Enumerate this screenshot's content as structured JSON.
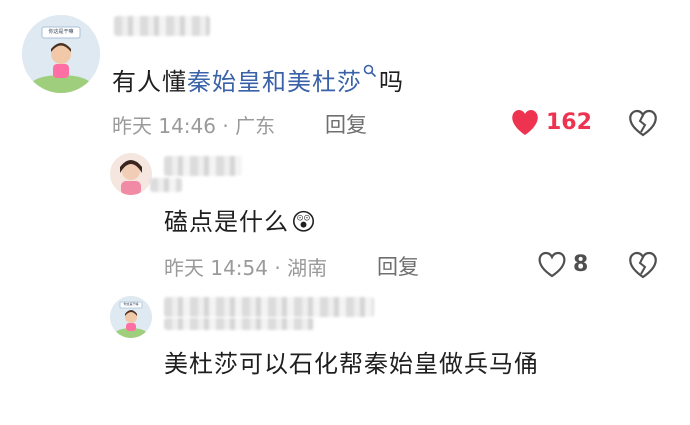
{
  "comments": [
    {
      "avatar_caption": "你这是干嘛",
      "text_before": "有人懂",
      "text_link": "秦始皇和美杜莎",
      "text_after": "吗",
      "meta": "昨天 14:46 · 广东",
      "reply_label": "回复",
      "likes": "162",
      "liked": true
    },
    {
      "text": "磕点是什么",
      "emoji": "😲",
      "meta": "昨天 14:54 · 湖南",
      "reply_label": "回复",
      "likes": "8",
      "liked": false
    },
    {
      "avatar_caption": "你这是干嘛",
      "text": "美杜莎可以石化帮秦始皇做兵马俑"
    }
  ],
  "colors": {
    "link": "#3a62a8",
    "like_active": "#ee3350",
    "meta": "#9a9a9a"
  },
  "icons": [
    "heart-filled-icon",
    "heart-outline-icon",
    "broken-heart-icon",
    "search-icon"
  ]
}
